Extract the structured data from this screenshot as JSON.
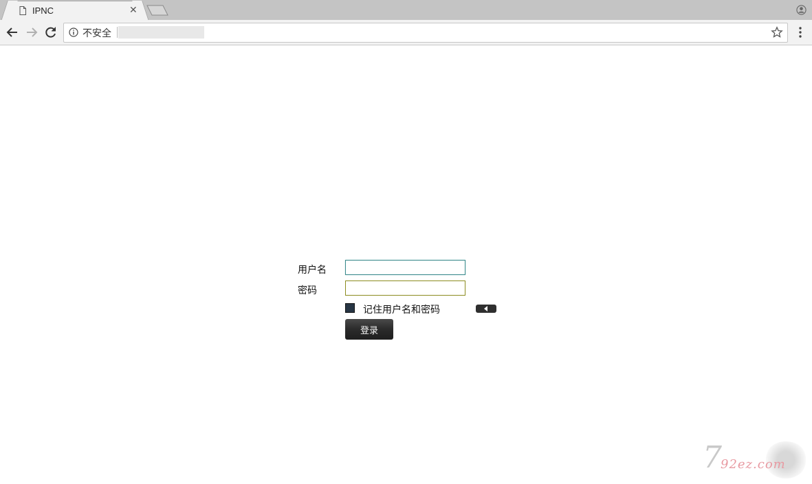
{
  "browser": {
    "tab": {
      "title": "IPNC"
    },
    "address_bar": {
      "security_label": "不安全"
    }
  },
  "login": {
    "username_label": "用户名",
    "password_label": "密码",
    "username_value": "",
    "password_value": "",
    "remember_label": "记住用户名和密码",
    "remember_checked": true,
    "submit_label": "登录"
  },
  "watermark": {
    "text": "92ez.com",
    "mark": "7"
  }
}
